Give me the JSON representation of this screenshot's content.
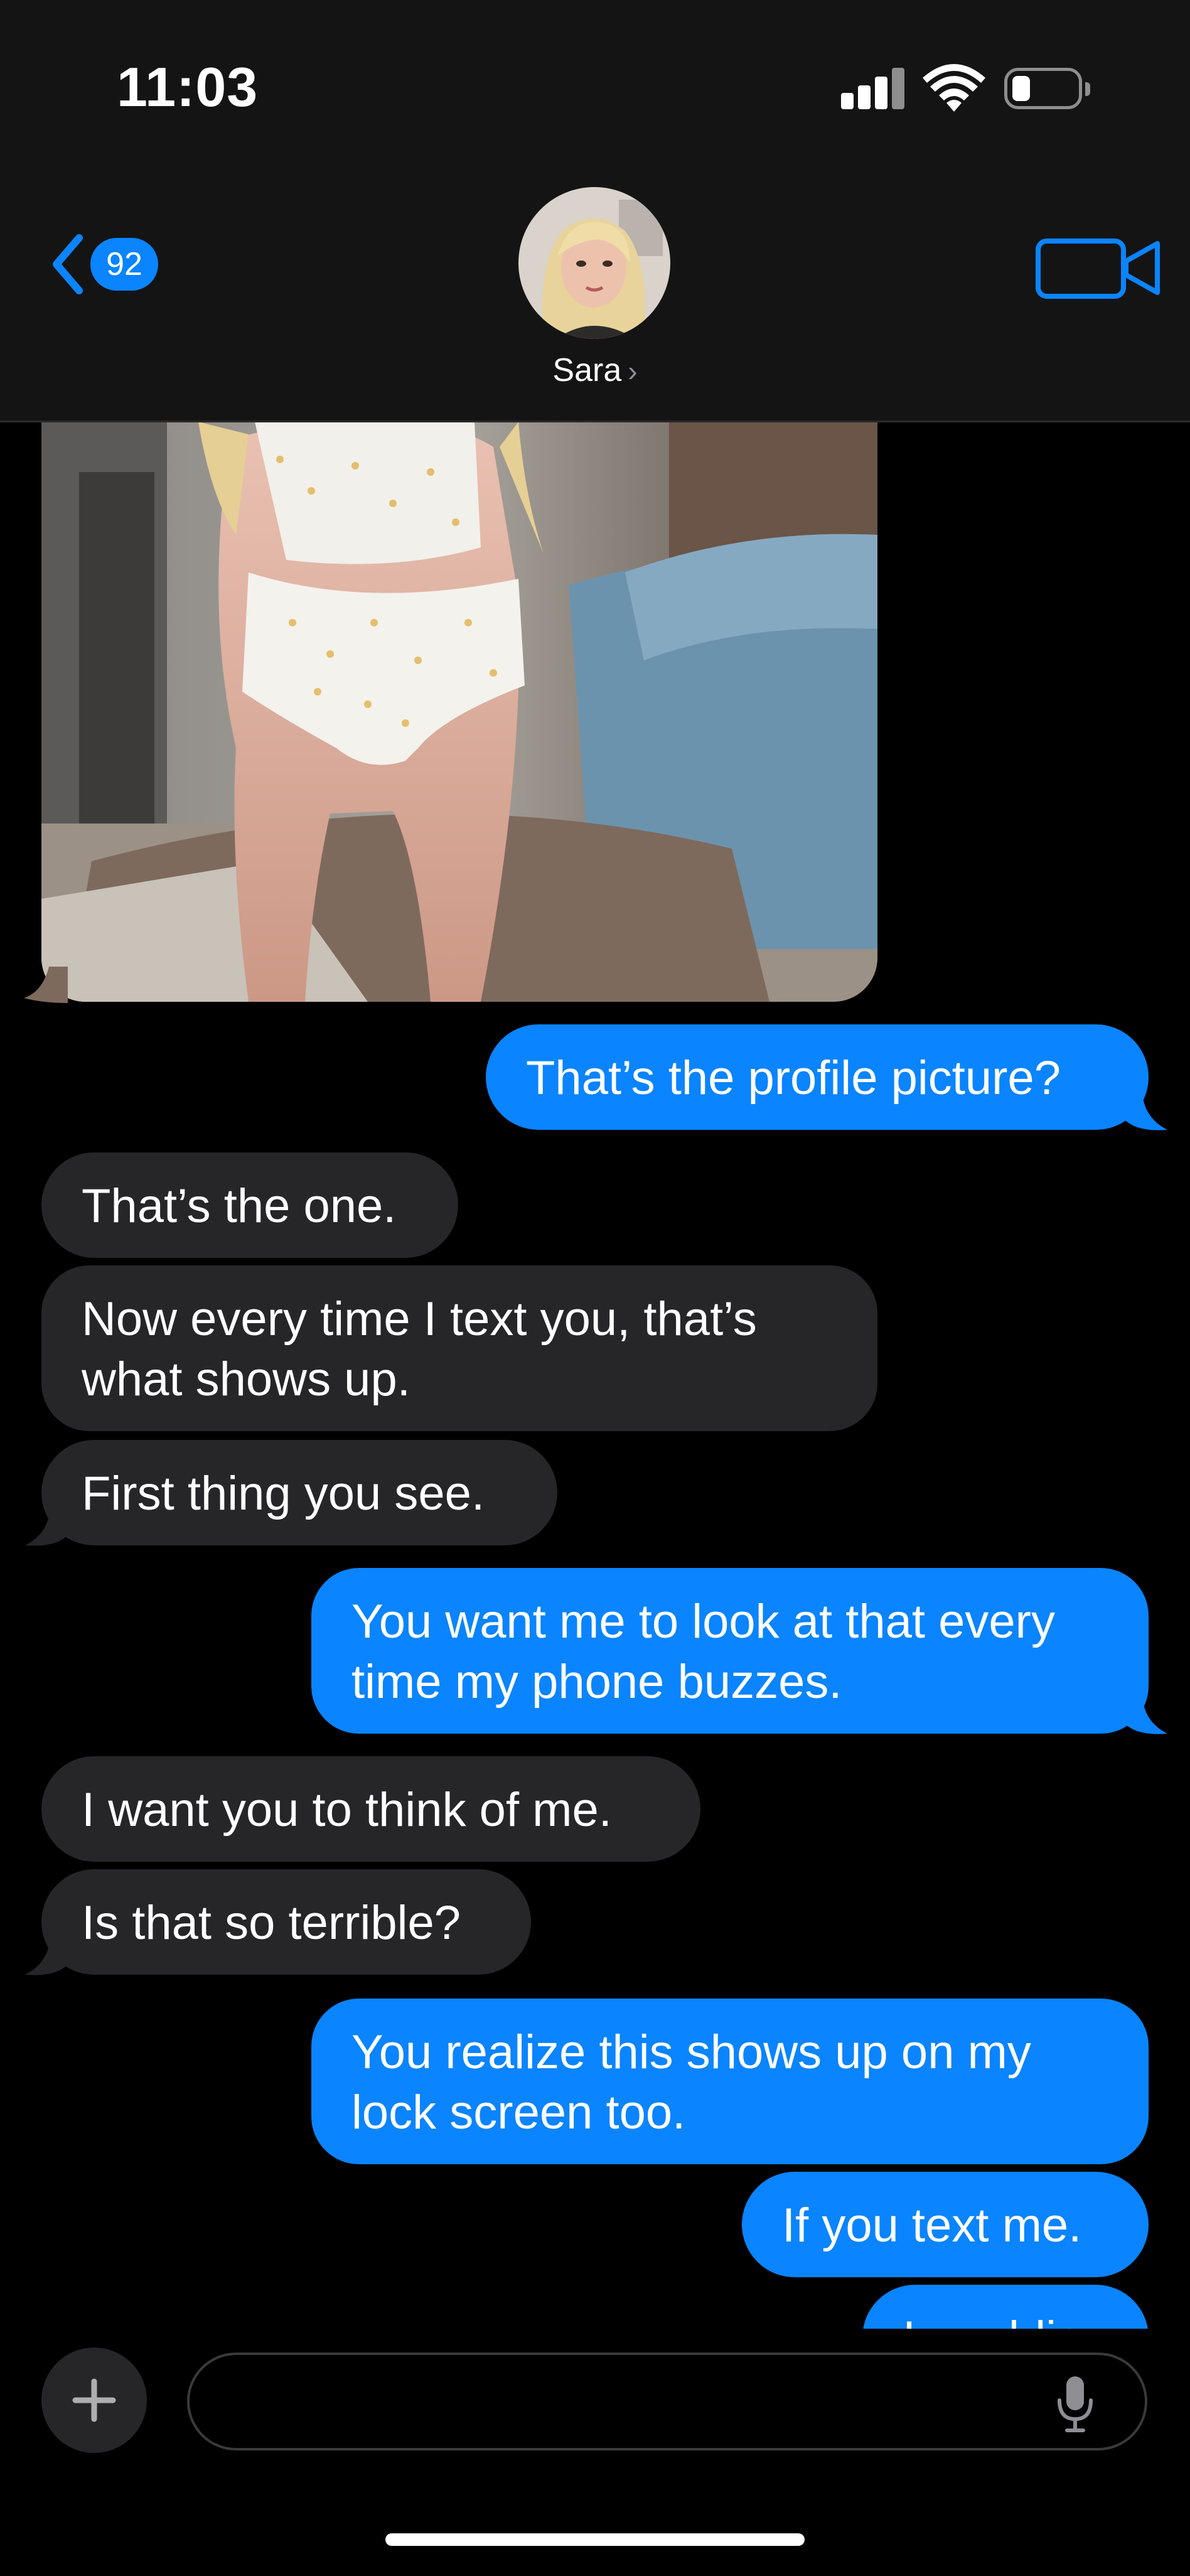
{
  "status_bar": {
    "time": "11:03",
    "battery_level": 0.15
  },
  "header": {
    "back_count": "92",
    "contact_name": "Sara",
    "icons": {
      "back": "chevron-left-icon",
      "video": "video-camera-icon",
      "contact": "chevron-right-icon"
    }
  },
  "colors": {
    "accent": "#0a84ff",
    "incoming_bubble": "#262628",
    "header_bg": "#141414",
    "background": "#000000"
  },
  "messages": [
    {
      "id": "m1",
      "direction": "outgoing",
      "text": "That’s the profile picture?"
    },
    {
      "id": "m2",
      "direction": "incoming",
      "text": "That’s the one."
    },
    {
      "id": "m3",
      "direction": "incoming",
      "text": "Now every time I text you, that’s what shows up."
    },
    {
      "id": "m4",
      "direction": "incoming",
      "text": "First thing you see."
    },
    {
      "id": "m5",
      "direction": "outgoing",
      "text": "You want me to look at that every time my phone buzzes."
    },
    {
      "id": "m6",
      "direction": "incoming",
      "text": "I want you to think of me."
    },
    {
      "id": "m7",
      "direction": "incoming",
      "text": "Is that so terrible?"
    },
    {
      "id": "m8",
      "direction": "outgoing",
      "text": "You realize this shows up on my lock screen too."
    },
    {
      "id": "m9",
      "direction": "outgoing",
      "text": "If you text me."
    },
    {
      "id": "m10",
      "direction": "outgoing",
      "text": "In public"
    }
  ],
  "composer": {
    "value": "",
    "icons": {
      "add": "plus-icon",
      "dictate": "microphone-icon"
    }
  }
}
